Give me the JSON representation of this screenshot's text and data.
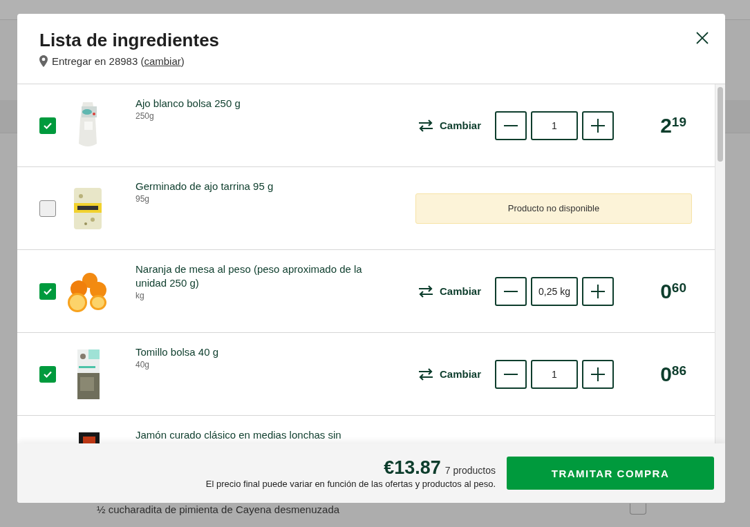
{
  "background": {
    "ingredient_text": "½ cucharadita de pimienta de Cayena desmenuzada",
    "ingredient_checked": false
  },
  "modal": {
    "title": "Lista de ingredientes",
    "delivery": {
      "before": "Entregar en 28983 (",
      "link": "cambiar",
      "after": ")"
    },
    "items": [
      {
        "kind": "available",
        "checked": true,
        "name": "Ajo blanco bolsa 250 g",
        "unit": "250g",
        "swap_label": "Cambiar",
        "quantity": "1",
        "price_int": "2",
        "price_dec": "19"
      },
      {
        "kind": "unavailable",
        "checked": false,
        "name": "Germinado de ajo tarrina 95 g",
        "unit": "95g",
        "notice": "Producto no disponible"
      },
      {
        "kind": "available",
        "checked": true,
        "name": "Naranja de mesa al peso (peso aproximado de la unidad 250 g)",
        "unit": "kg",
        "swap_label": "Cambiar",
        "quantity": "0,25 kg",
        "price_int": "0",
        "price_dec": "60"
      },
      {
        "kind": "available",
        "checked": true,
        "name": "Tomillo bolsa 40 g",
        "unit": "40g",
        "swap_label": "Cambiar",
        "quantity": "1",
        "price_int": "0",
        "price_dec": "86"
      },
      {
        "kind": "cut",
        "name": "Jamón curado clásico en medias lonchas sin"
      }
    ],
    "footer": {
      "total": "€13.87",
      "count": "7 productos",
      "note": "El precio final puede variar en función de las ofertas y productos al peso.",
      "button": "TRAMITAR COMPRA"
    }
  }
}
